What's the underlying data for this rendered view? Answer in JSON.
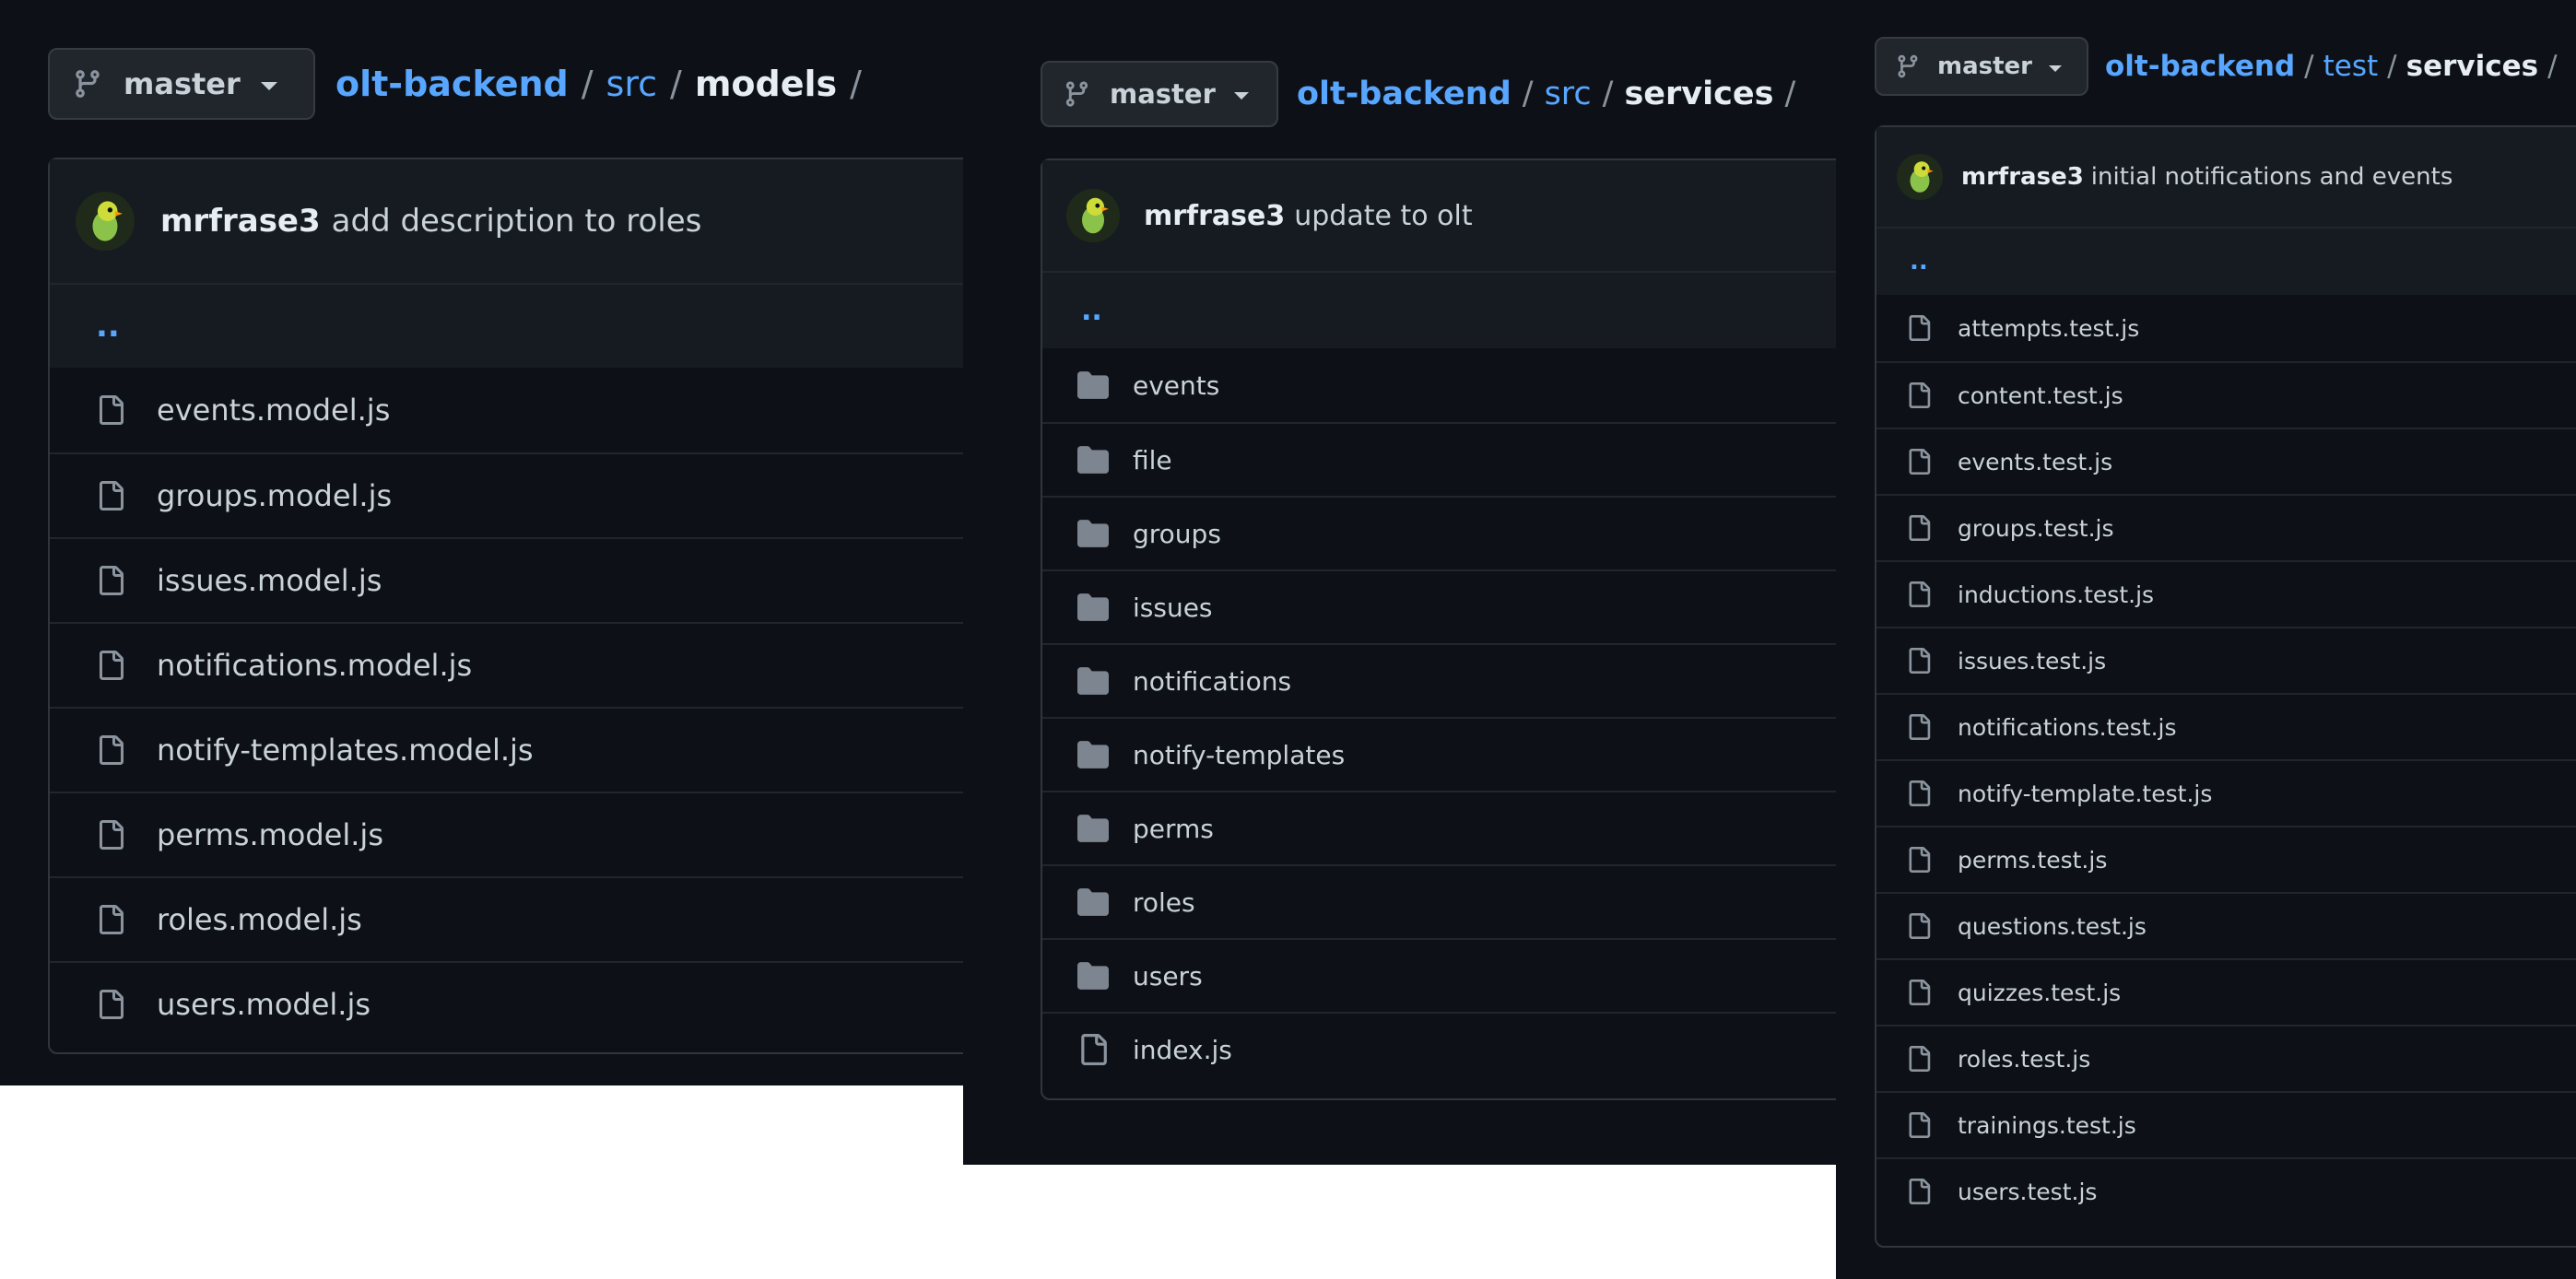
{
  "panel1": {
    "branch": "master",
    "crumbs": {
      "repo": "olt-backend",
      "dir1": "src",
      "current": "models",
      "sep": "/"
    },
    "commit": {
      "author": "mrfrase3",
      "message": "add description to roles"
    },
    "parent_link": "..",
    "files": [
      "events.model.js",
      "groups.model.js",
      "issues.model.js",
      "notifications.model.js",
      "notify-templates.model.js",
      "perms.model.js",
      "roles.model.js",
      "users.model.js"
    ]
  },
  "panel2": {
    "branch": "master",
    "crumbs": {
      "repo": "olt-backend",
      "dir1": "src",
      "current": "services",
      "sep": "/"
    },
    "commit": {
      "author": "mrfrase3",
      "message": "update to olt"
    },
    "parent_link": "..",
    "items": [
      {
        "name": "events",
        "kind": "folder"
      },
      {
        "name": "file",
        "kind": "folder"
      },
      {
        "name": "groups",
        "kind": "folder"
      },
      {
        "name": "issues",
        "kind": "folder"
      },
      {
        "name": "notifications",
        "kind": "folder"
      },
      {
        "name": "notify-templates",
        "kind": "folder"
      },
      {
        "name": "perms",
        "kind": "folder"
      },
      {
        "name": "roles",
        "kind": "folder"
      },
      {
        "name": "users",
        "kind": "folder"
      },
      {
        "name": "index.js",
        "kind": "file"
      }
    ]
  },
  "panel3": {
    "branch": "master",
    "crumbs": {
      "repo": "olt-backend",
      "dir1": "test",
      "current": "services",
      "sep": "/"
    },
    "commit": {
      "author": "mrfrase3",
      "message": "initial notifications and events"
    },
    "parent_link": "..",
    "files": [
      "attempts.test.js",
      "content.test.js",
      "events.test.js",
      "groups.test.js",
      "inductions.test.js",
      "issues.test.js",
      "notifications.test.js",
      "notify-template.test.js",
      "perms.test.js",
      "questions.test.js",
      "quizzes.test.js",
      "roles.test.js",
      "trainings.test.js",
      "users.test.js"
    ]
  },
  "icons": {
    "branch": "git-branch-icon",
    "caret": "caret-down-icon",
    "file": "file-icon",
    "folder": "folder-icon",
    "avatar": "parrot-avatar"
  },
  "colors": {
    "bg": "#0d1117",
    "link": "#58a6ff",
    "text": "#c9d1d9",
    "border": "#30363d"
  }
}
